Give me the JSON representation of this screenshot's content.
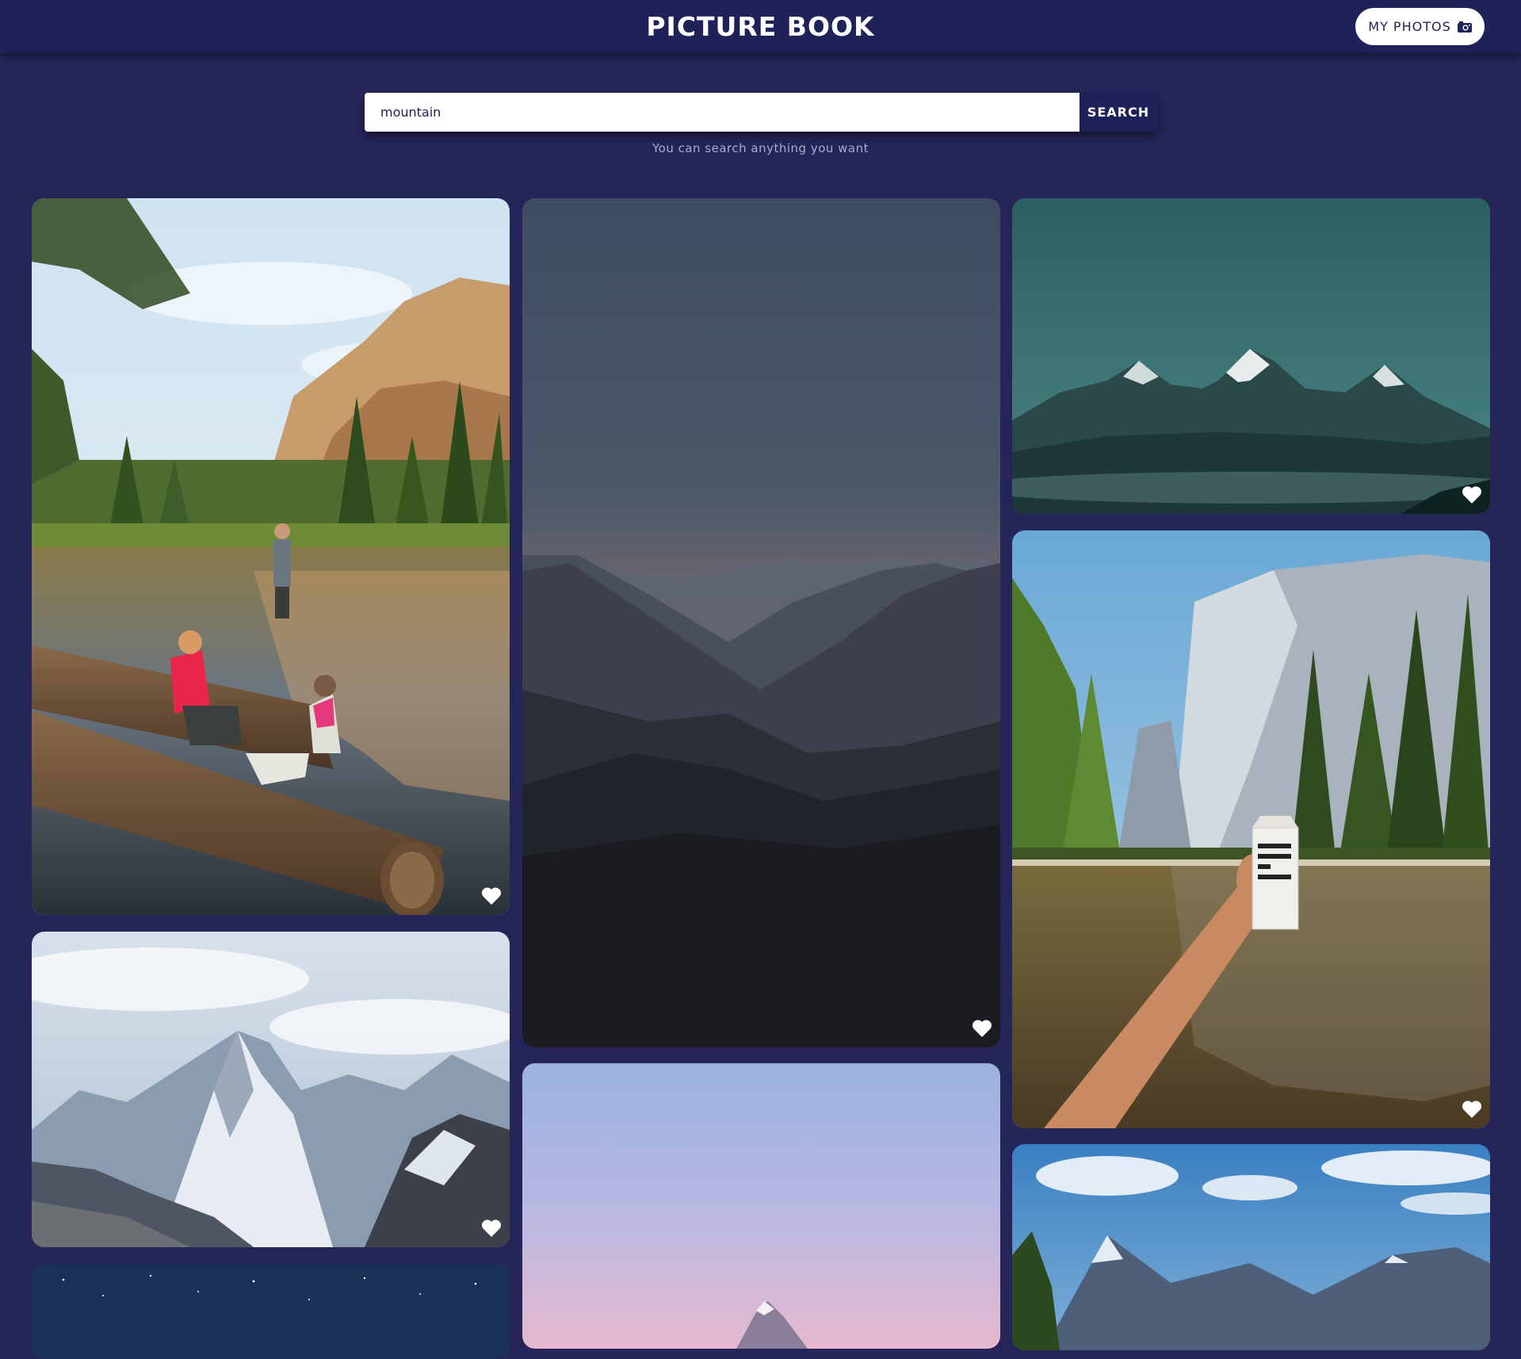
{
  "header": {
    "brand": "PICTURE BOOK",
    "my_photos_label": "MY PHOTOS",
    "my_photos_icon": "camera-icon"
  },
  "search": {
    "value": "mountain",
    "button_label": "SEARCH",
    "helper_text": "You can search anything you want"
  },
  "photos": [
    {
      "subject": "yosemite-river-friends",
      "icon": "heart-icon"
    },
    {
      "subject": "misty-mountain-ridges",
      "icon": "heart-icon"
    },
    {
      "subject": "teal-snowy-peaks",
      "icon": "heart-icon"
    },
    {
      "subject": "el-capitan-boxed-water",
      "icon": "heart-icon"
    },
    {
      "subject": "himalaya-snow-peaks",
      "icon": "heart-icon"
    },
    {
      "subject": "pink-sky-peak",
      "icon": "heart-icon"
    },
    {
      "subject": "starry-night",
      "icon": "heart-icon"
    },
    {
      "subject": "blue-mountain-valley",
      "icon": "heart-icon"
    }
  ],
  "colors": {
    "background": "#25255a",
    "header": "#1f2159",
    "accent": "#ffffff"
  }
}
